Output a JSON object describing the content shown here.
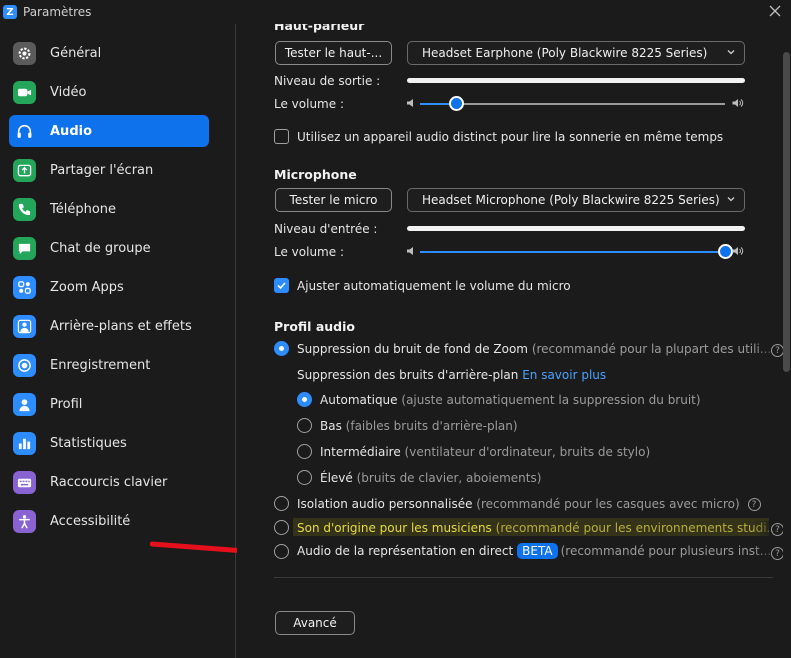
{
  "window": {
    "title": "Paramètres",
    "logo_letter": "Z"
  },
  "sidebar": {
    "items": [
      {
        "label": "Général",
        "icon": "gear-icon",
        "color": "#5b5b5b"
      },
      {
        "label": "Vidéo",
        "icon": "video-icon",
        "color": "#23a55a"
      },
      {
        "label": "Audio",
        "icon": "headphones-icon",
        "color": "#0e72ed",
        "active": true
      },
      {
        "label": "Partager l'écran",
        "icon": "share-screen-icon",
        "color": "#23a55a"
      },
      {
        "label": "Téléphone",
        "icon": "phone-icon",
        "color": "#23a55a"
      },
      {
        "label": "Chat de groupe",
        "icon": "chat-icon",
        "color": "#23a55a"
      },
      {
        "label": "Zoom Apps",
        "icon": "apps-icon",
        "color": "#2d8cff"
      },
      {
        "label": "Arrière-plans et effets",
        "icon": "person-icon",
        "color": "#2d8cff"
      },
      {
        "label": "Enregistrement",
        "icon": "record-icon",
        "color": "#2d8cff"
      },
      {
        "label": "Profil",
        "icon": "profile-icon",
        "color": "#2d8cff"
      },
      {
        "label": "Statistiques",
        "icon": "stats-icon",
        "color": "#2d8cff"
      },
      {
        "label": "Raccourcis clavier",
        "icon": "keyboard-icon",
        "color": "#8a63d2"
      },
      {
        "label": "Accessibilité",
        "icon": "accessibility-icon",
        "color": "#8a63d2"
      }
    ]
  },
  "speaker": {
    "title": "Haut-parleur",
    "test_label": "Tester le haut-...",
    "device": "Headset Earphone (Poly Blackwire 8225 Series)",
    "output_level_label": "Niveau de sortie :",
    "volume_label": "Le volume :",
    "volume_percent": 12
  },
  "separate_ringer": {
    "label": "Utilisez un appareil audio distinct pour lire la sonnerie en même temps",
    "checked": false
  },
  "microphone": {
    "title": "Microphone",
    "test_label": "Tester le micro",
    "device": "Headset Microphone (Poly Blackwire 8225 Series)",
    "input_level_label": "Niveau d'entrée :",
    "volume_label": "Le volume :",
    "volume_percent": 100
  },
  "auto_adjust": {
    "label": "Ajuster automatiquement le volume du micro",
    "checked": true
  },
  "audio_profile": {
    "title": "Profil audio",
    "zoom_suppression": {
      "label": "Suppression du bruit de fond de Zoom",
      "hint": "(recommandé pour la plupart des utili..."
    },
    "background_suppression_label": "Suppression des bruits d'arrière-plan",
    "learn_more": "En savoir plus",
    "levels": [
      {
        "label": "Automatique",
        "hint": "(ajuste automatiquement la suppression du bruit)",
        "checked": true
      },
      {
        "label": "Bas",
        "hint": "(faibles bruits d'arrière-plan)",
        "checked": false
      },
      {
        "label": "Intermédiaire",
        "hint": "(ventilateur d'ordinateur, bruits de stylo)",
        "checked": false
      },
      {
        "label": "Élevé",
        "hint": "(bruits de clavier, aboiements)",
        "checked": false
      }
    ],
    "isolation": {
      "label": "Isolation audio personnalisée",
      "hint": "(recommandé pour les casques avec micro)"
    },
    "original_sound": {
      "label": "Son d'origine pour les musiciens",
      "hint": "(recommandé pour les environnements studi..."
    },
    "live_performance": {
      "label": "Audio de la représentation en direct",
      "badge": "BETA",
      "hint": "(recommandé pour plusieurs inst..."
    }
  },
  "advanced_label": "Avancé",
  "help_glyph": "?",
  "colors": {
    "accent": "#0e72ed",
    "link": "#4aa3ff",
    "annotation": "#e5101b"
  }
}
